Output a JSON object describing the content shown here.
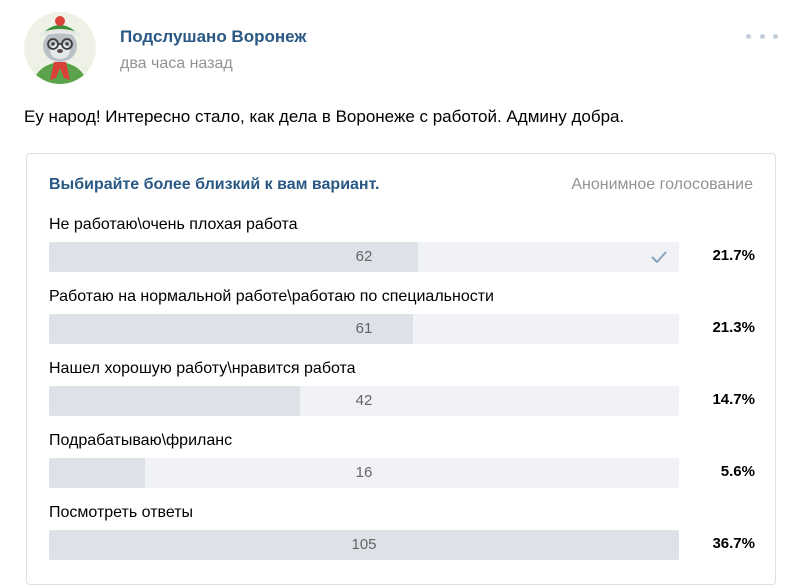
{
  "post": {
    "author": "Подслушано Воронеж",
    "time": "два часа назад",
    "text": "Еу народ! Интересно стало, как дела в Воронеже с работой. Админу добра."
  },
  "poll": {
    "question": "Выбирайте более близкий к вам вариант.",
    "type": "Анонимное голосование",
    "options": [
      {
        "label": "Не работаю\\очень плохая работа",
        "count": "62",
        "percent": "21.7%",
        "share": 0.586,
        "voted": true
      },
      {
        "label": "Работаю на нормальной работе\\работаю по специальности",
        "count": "61",
        "percent": "21.3%",
        "share": 0.577,
        "voted": false
      },
      {
        "label": "Нашел хорошую работу\\нравится работа",
        "count": "42",
        "percent": "14.7%",
        "share": 0.398,
        "voted": false
      },
      {
        "label": "Подрабатываю\\фриланс",
        "count": "16",
        "percent": "5.6%",
        "share": 0.152,
        "voted": false
      },
      {
        "label": "Посмотреть ответы",
        "count": "105",
        "percent": "36.7%",
        "share": 1.0,
        "voted": false
      }
    ]
  },
  "colors": {
    "link": "#2a5885",
    "muted": "#939393",
    "bar_fill": "#dde2e8",
    "bar_track": "#f0f2f5",
    "check": "#8aa4bd"
  },
  "icons": {
    "more": "more-dots-icon",
    "check": "check-icon"
  }
}
